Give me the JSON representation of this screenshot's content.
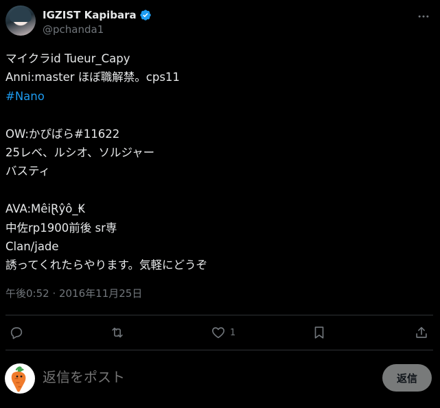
{
  "author": {
    "display_name": "IGZIST Kapibara",
    "handle": "@pchanda1"
  },
  "tweet": {
    "lines": [
      "マイクラid Tueur_Capy",
      "Anni:master ほぼ職解禁。cps11",
      "#Nano",
      "",
      "OW:かぴばら#11622",
      "25レベ、ルシオ、ソルジャー",
      "バスティ",
      "",
      "AVA:MêiⱤŷô_₭",
      "中佐rp1900前後 sr専",
      "Clan/jade",
      "誘ってくれたらやります。気軽にどうぞ"
    ],
    "timestamp": "午後0:52 · 2016年11月25日"
  },
  "actions": {
    "reply_count": "",
    "retweet_count": "",
    "like_count": "1",
    "bookmark_count": ""
  },
  "reply": {
    "placeholder": "返信をポスト",
    "button_label": "返信"
  },
  "colors": {
    "background": "#000000",
    "text": "#e7e9ea",
    "muted": "#71767b",
    "hashtag": "#1d9bf0",
    "verified": "#1d9bf0",
    "divider": "#2f3336",
    "reply_button": "#787a7a"
  },
  "icons": {
    "more": "more-dots-icon",
    "verified": "verified-badge-icon",
    "reply": "reply-bubble-icon",
    "retweet": "retweet-icon",
    "like": "heart-icon",
    "bookmark": "bookmark-icon",
    "share": "share-icon"
  }
}
